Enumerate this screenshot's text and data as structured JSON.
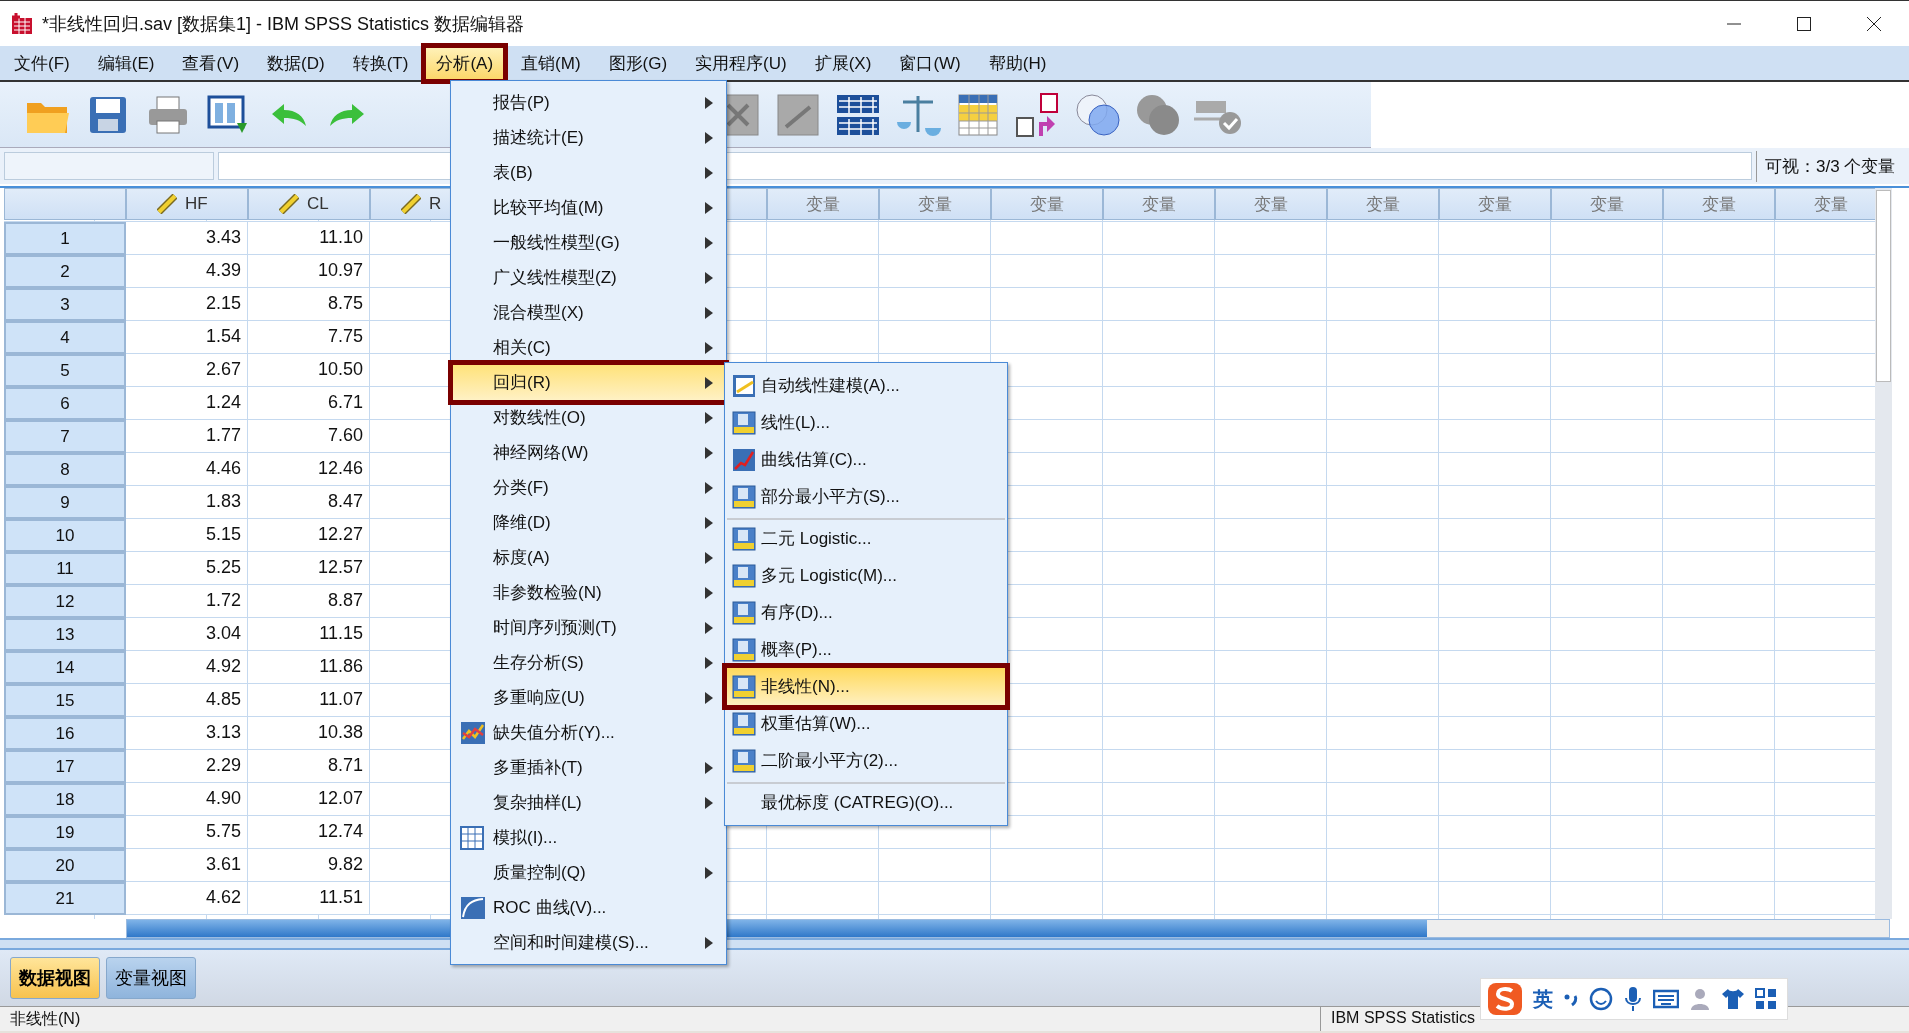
{
  "window": {
    "title": "*非线性回归.sav [数据集1] - IBM SPSS Statistics 数据编辑器"
  },
  "menu_bar": [
    {
      "label": "文件(F)",
      "selected": false,
      "highlighted": false
    },
    {
      "label": "编辑(E)",
      "selected": false,
      "highlighted": false
    },
    {
      "label": "查看(V)",
      "selected": false,
      "highlighted": false
    },
    {
      "label": "数据(D)",
      "selected": false,
      "highlighted": false
    },
    {
      "label": "转换(T)",
      "selected": false,
      "highlighted": false
    },
    {
      "label": "分析(A)",
      "selected": true,
      "highlighted": true
    },
    {
      "label": "直销(M)",
      "selected": false,
      "highlighted": false
    },
    {
      "label": "图形(G)",
      "selected": false,
      "highlighted": false
    },
    {
      "label": "实用程序(U)",
      "selected": false,
      "highlighted": false
    },
    {
      "label": "扩展(X)",
      "selected": false,
      "highlighted": false
    },
    {
      "label": "窗口(W)",
      "selected": false,
      "highlighted": false
    },
    {
      "label": "帮助(H)",
      "selected": false,
      "highlighted": false
    }
  ],
  "visible_vars": "可视：3/3 个变量",
  "grid": {
    "columns": [
      {
        "label": "HF",
        "kind": "scale"
      },
      {
        "label": "CL",
        "kind": "scale"
      },
      {
        "label": "R",
        "kind": "scale"
      },
      {
        "label": "变量",
        "kind": "empty"
      },
      {
        "label": "变量",
        "kind": "empty"
      },
      {
        "label": "变量",
        "kind": "empty"
      },
      {
        "label": "变量",
        "kind": "empty"
      },
      {
        "label": "变量",
        "kind": "empty"
      },
      {
        "label": "变量",
        "kind": "empty"
      },
      {
        "label": "变量",
        "kind": "empty"
      },
      {
        "label": "变量",
        "kind": "empty"
      },
      {
        "label": "变量",
        "kind": "empty"
      },
      {
        "label": "变量",
        "kind": "empty"
      }
    ],
    "rows": [
      {
        "number": "1",
        "cells": [
          "3.43",
          "11.10"
        ]
      },
      {
        "number": "2",
        "cells": [
          "4.39",
          "10.97"
        ]
      },
      {
        "number": "3",
        "cells": [
          "2.15",
          "8.75"
        ]
      },
      {
        "number": "4",
        "cells": [
          "1.54",
          "7.75"
        ]
      },
      {
        "number": "5",
        "cells": [
          "2.67",
          "10.50"
        ]
      },
      {
        "number": "6",
        "cells": [
          "1.24",
          "6.71"
        ]
      },
      {
        "number": "7",
        "cells": [
          "1.77",
          "7.60"
        ]
      },
      {
        "number": "8",
        "cells": [
          "4.46",
          "12.46"
        ]
      },
      {
        "number": "9",
        "cells": [
          "1.83",
          "8.47"
        ]
      },
      {
        "number": "10",
        "cells": [
          "5.15",
          "12.27"
        ]
      },
      {
        "number": "11",
        "cells": [
          "5.25",
          "12.57"
        ]
      },
      {
        "number": "12",
        "cells": [
          "1.72",
          "8.87"
        ]
      },
      {
        "number": "13",
        "cells": [
          "3.04",
          "11.15"
        ]
      },
      {
        "number": "14",
        "cells": [
          "4.92",
          "11.86"
        ]
      },
      {
        "number": "15",
        "cells": [
          "4.85",
          "11.07"
        ]
      },
      {
        "number": "16",
        "cells": [
          "3.13",
          "10.38"
        ]
      },
      {
        "number": "17",
        "cells": [
          "2.29",
          "8.71"
        ]
      },
      {
        "number": "18",
        "cells": [
          "4.90",
          "12.07"
        ]
      },
      {
        "number": "19",
        "cells": [
          "5.75",
          "12.74"
        ]
      },
      {
        "number": "20",
        "cells": [
          "3.61",
          "9.82"
        ]
      },
      {
        "number": "21",
        "cells": [
          "4.62",
          "11.51"
        ]
      }
    ]
  },
  "analyze_menu": [
    {
      "label": "报告(P)",
      "submenu": true,
      "kind": "plain",
      "selected": false,
      "highlighted": false
    },
    {
      "label": "描述统计(E)",
      "submenu": true,
      "kind": "plain",
      "selected": false,
      "highlighted": false
    },
    {
      "label": "表(B)",
      "submenu": true,
      "kind": "plain",
      "selected": false,
      "highlighted": false
    },
    {
      "label": "比较平均值(M)",
      "submenu": true,
      "kind": "plain",
      "selected": false,
      "highlighted": false
    },
    {
      "label": "一般线性模型(G)",
      "submenu": true,
      "kind": "plain",
      "selected": false,
      "highlighted": false
    },
    {
      "label": "广义线性模型(Z)",
      "submenu": true,
      "kind": "plain",
      "selected": false,
      "highlighted": false
    },
    {
      "label": "混合模型(X)",
      "submenu": true,
      "kind": "plain",
      "selected": false,
      "highlighted": false
    },
    {
      "label": "相关(C)",
      "submenu": true,
      "kind": "plain",
      "selected": false,
      "highlighted": false
    },
    {
      "label": "回归(R)",
      "submenu": true,
      "kind": "plain",
      "selected": true,
      "highlighted": true
    },
    {
      "label": "对数线性(O)",
      "submenu": true,
      "kind": "plain",
      "selected": false,
      "highlighted": false
    },
    {
      "label": "神经网络(W)",
      "submenu": true,
      "kind": "plain",
      "selected": false,
      "highlighted": false
    },
    {
      "label": "分类(F)",
      "submenu": true,
      "kind": "plain",
      "selected": false,
      "highlighted": false
    },
    {
      "label": "降维(D)",
      "submenu": true,
      "kind": "plain",
      "selected": false,
      "highlighted": false
    },
    {
      "label": "标度(A)",
      "submenu": true,
      "kind": "plain",
      "selected": false,
      "highlighted": false
    },
    {
      "label": "非参数检验(N)",
      "submenu": true,
      "kind": "plain",
      "selected": false,
      "highlighted": false
    },
    {
      "label": "时间序列预测(T)",
      "submenu": true,
      "kind": "plain",
      "selected": false,
      "highlighted": false
    },
    {
      "label": "生存分析(S)",
      "submenu": true,
      "kind": "plain",
      "selected": false,
      "highlighted": false
    },
    {
      "label": "多重响应(U)",
      "submenu": true,
      "kind": "plain",
      "selected": false,
      "highlighted": false
    },
    {
      "label": "缺失值分析(Y)...",
      "submenu": false,
      "kind": "missing",
      "selected": false,
      "highlighted": false
    },
    {
      "label": "多重插补(T)",
      "submenu": true,
      "kind": "plain",
      "selected": false,
      "highlighted": false
    },
    {
      "label": "复杂抽样(L)",
      "submenu": true,
      "kind": "plain",
      "selected": false,
      "highlighted": false
    },
    {
      "label": "模拟(I)...",
      "submenu": false,
      "kind": "simulation",
      "selected": false,
      "highlighted": false
    },
    {
      "label": "质量控制(Q)",
      "submenu": true,
      "kind": "plain",
      "selected": false,
      "highlighted": false
    },
    {
      "label": "ROC 曲线(V)...",
      "submenu": false,
      "kind": "roc",
      "selected": false,
      "highlighted": false
    },
    {
      "label": "空间和时间建模(S)...",
      "submenu": true,
      "kind": "plain",
      "selected": false,
      "highlighted": false
    }
  ],
  "regression_menu": [
    {
      "label": "自动线性建模(A)...",
      "kind": "auto",
      "separator_before": false,
      "selected": false,
      "highlighted": false
    },
    {
      "label": "线性(L)...",
      "kind": "r",
      "separator_before": false,
      "selected": false,
      "highlighted": false
    },
    {
      "label": "曲线估算(C)...",
      "kind": "curve",
      "separator_before": false,
      "selected": false,
      "highlighted": false
    },
    {
      "label": "部分最小平方(S)...",
      "kind": "r",
      "separator_before": false,
      "selected": false,
      "highlighted": false
    },
    {
      "label": "二元 Logistic...",
      "kind": "r",
      "separator_before": true,
      "selected": false,
      "highlighted": false
    },
    {
      "label": "多元 Logistic(M)...",
      "kind": "r",
      "separator_before": false,
      "selected": false,
      "highlighted": false
    },
    {
      "label": "有序(D)...",
      "kind": "r",
      "separator_before": false,
      "selected": false,
      "highlighted": false
    },
    {
      "label": "概率(P)...",
      "kind": "r",
      "separator_before": false,
      "selected": false,
      "highlighted": false
    },
    {
      "label": "非线性(N)...",
      "kind": "r",
      "separator_before": false,
      "selected": true,
      "highlighted": true
    },
    {
      "label": "权重估算(W)...",
      "kind": "r",
      "separator_before": false,
      "selected": false,
      "highlighted": false
    },
    {
      "label": "二阶最小平方(2)...",
      "kind": "r",
      "separator_before": false,
      "selected": false,
      "highlighted": false
    },
    {
      "label": "最优标度 (CATREG)(O)...",
      "kind": "plain",
      "separator_before": true,
      "selected": false,
      "highlighted": false
    }
  ],
  "view_tabs": [
    {
      "label": "数据视图",
      "selected": true
    },
    {
      "label": "变量视图",
      "selected": false
    }
  ],
  "status_bar": {
    "left": "非线性(N)",
    "right": "IBM SPSS Statistics"
  },
  "ime_bar": {
    "mode": "英"
  }
}
